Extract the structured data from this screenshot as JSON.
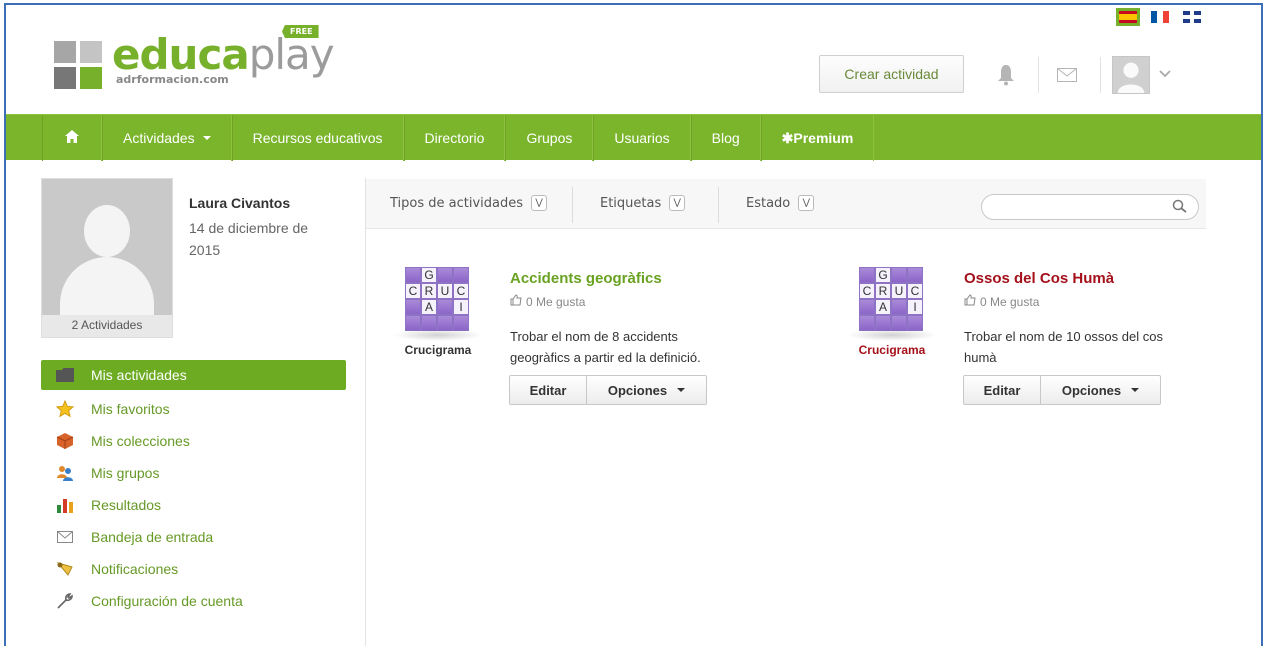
{
  "logo": {
    "word_main": "educa",
    "word_play": "play",
    "sub": "adrformacion.com",
    "free": "FREE"
  },
  "languages": [
    {
      "code": "es",
      "selected": true
    },
    {
      "code": "fr",
      "selected": false
    },
    {
      "code": "en",
      "selected": false
    }
  ],
  "header": {
    "create_label": "Crear actividad",
    "icons": [
      "bell-icon",
      "mail-icon",
      "user-avatar-icon",
      "chevron-down-icon"
    ]
  },
  "nav": {
    "home_icon": "home-icon",
    "items": [
      {
        "label": "Actividades",
        "has_caret": true
      },
      {
        "label": "Recursos educativos"
      },
      {
        "label": "Directorio"
      },
      {
        "label": "Grupos"
      },
      {
        "label": "Usuarios"
      },
      {
        "label": "Blog"
      },
      {
        "label": "Premium",
        "prefix": "✱"
      }
    ]
  },
  "profile": {
    "name": "Laura Civantos",
    "date": "14 de diciembre de 2015",
    "activities": "2 Actividades"
  },
  "sidebar": {
    "items": [
      {
        "label": "Mis actividades",
        "icon": "folder-icon",
        "active": true
      },
      {
        "label": "Mis favoritos",
        "icon": "star-icon"
      },
      {
        "label": "Mis colecciones",
        "icon": "box-icon"
      },
      {
        "label": "Mis grupos",
        "icon": "group-icon"
      },
      {
        "label": "Resultados",
        "icon": "bar-chart-icon"
      },
      {
        "label": "Bandeja de entrada",
        "icon": "mail-icon"
      },
      {
        "label": "Notificaciones",
        "icon": "megaphone-icon"
      },
      {
        "label": "Configuración de cuenta",
        "icon": "wrench-icon"
      }
    ]
  },
  "filters": {
    "types": "Tipos de actividades",
    "tags": "Etiquetas",
    "status": "Estado",
    "search_placeholder": ""
  },
  "activities": [
    {
      "title": "Accidents geogràfics",
      "title_color": "#6aa222",
      "likes": "0 Me gusta",
      "description": "Trobar el nom de 8 accidents geogràfics a partir ed la definició.",
      "type": "Crucigrama",
      "type_color": "#333333",
      "edit": "Editar",
      "options": "Opciones"
    },
    {
      "title": "Ossos del Cos Humà",
      "title_color": "#a4111b",
      "likes": "0 Me gusta",
      "description": "Trobar el nom de 10 ossos del cos humà",
      "type": "Crucigrama",
      "type_color": "#a4111b",
      "edit": "Editar",
      "options": "Opciones"
    }
  ],
  "crossword_letters": [
    "",
    "G",
    "",
    "",
    "C",
    "R",
    "U",
    "C",
    "",
    "A",
    "",
    "I",
    "",
    "",
    "",
    ""
  ],
  "colors": {
    "brand_green": "#7ab52c",
    "frame_blue": "#3d6fb6"
  }
}
